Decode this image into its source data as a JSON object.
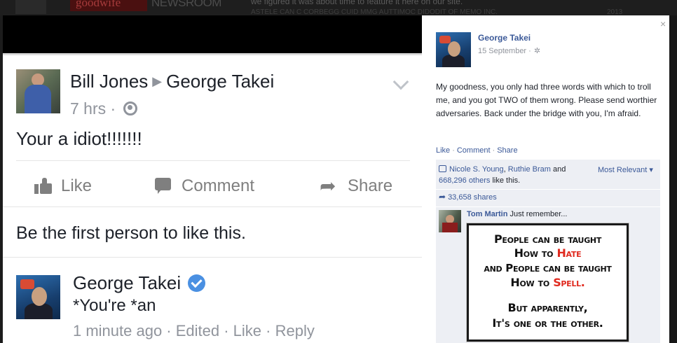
{
  "background": {
    "logo": "goodwife",
    "newsroom": "NEWSROOM",
    "text_line1": "we figured it was about time to feature it here on our site.",
    "text_line2": "ASTELE CAN C CORBEGG CUID MMG AUTTIMOC DIDODIT OF MEMO INC.",
    "year": "2013"
  },
  "mobile_post": {
    "author": "Bill Jones",
    "arrow": "▶",
    "target": "George Takei",
    "time": "7 hrs",
    "time_sep": "·",
    "body": "Your a idiot!!!!!!!",
    "actions": {
      "like": "Like",
      "comment": "Comment",
      "share": "Share"
    },
    "likes_text": "Be the first person to like this.",
    "comment": {
      "author": "George Takei",
      "text": "*You're *an",
      "meta": "1 minute ago · Edited · Like · Reply"
    }
  },
  "desktop_post": {
    "close": "×",
    "author": "George Takei",
    "date": "15 September ·",
    "body": "My goodness, you only had three words with which to troll me, and you got TWO of them wrong. Please send worthier adversaries. Back under the bridge with you, I'm afraid.",
    "actions": {
      "like": "Like",
      "comment": "Comment",
      "share": "Share",
      "sep": "·"
    },
    "likes": {
      "name1": "Nicole S. Young",
      "sep": ", ",
      "name2": "Ruthie Bram",
      "and": " and ",
      "others": "668,296 others",
      "suffix": " like this."
    },
    "most_relevant": "Most Relevant ▾",
    "shares": "33,658 shares",
    "comment": {
      "author": "Tom Martin",
      "text": " Just remember..."
    },
    "meme": {
      "line1": "People can be taught",
      "line2a": "How to ",
      "line2b": "Hate",
      "line3": "and People can be taught",
      "line4a": "How to ",
      "line4b": "Spell.",
      "line5": "But apparently,",
      "line6": "It's one or the other."
    }
  },
  "colors": {
    "fb_blue": "#3b5998",
    "text_dark": "#1d2129",
    "text_grey": "#90949c",
    "verified_blue": "#4a90e2",
    "meme_red": "#e02a1f",
    "ufi_bg": "#edeff4"
  },
  "icons": [
    "globe-icon",
    "chevron-down-icon",
    "like-icon",
    "comment-icon",
    "share-icon",
    "verified-badge-icon",
    "gear-icon",
    "close-icon",
    "thumb-icon"
  ]
}
